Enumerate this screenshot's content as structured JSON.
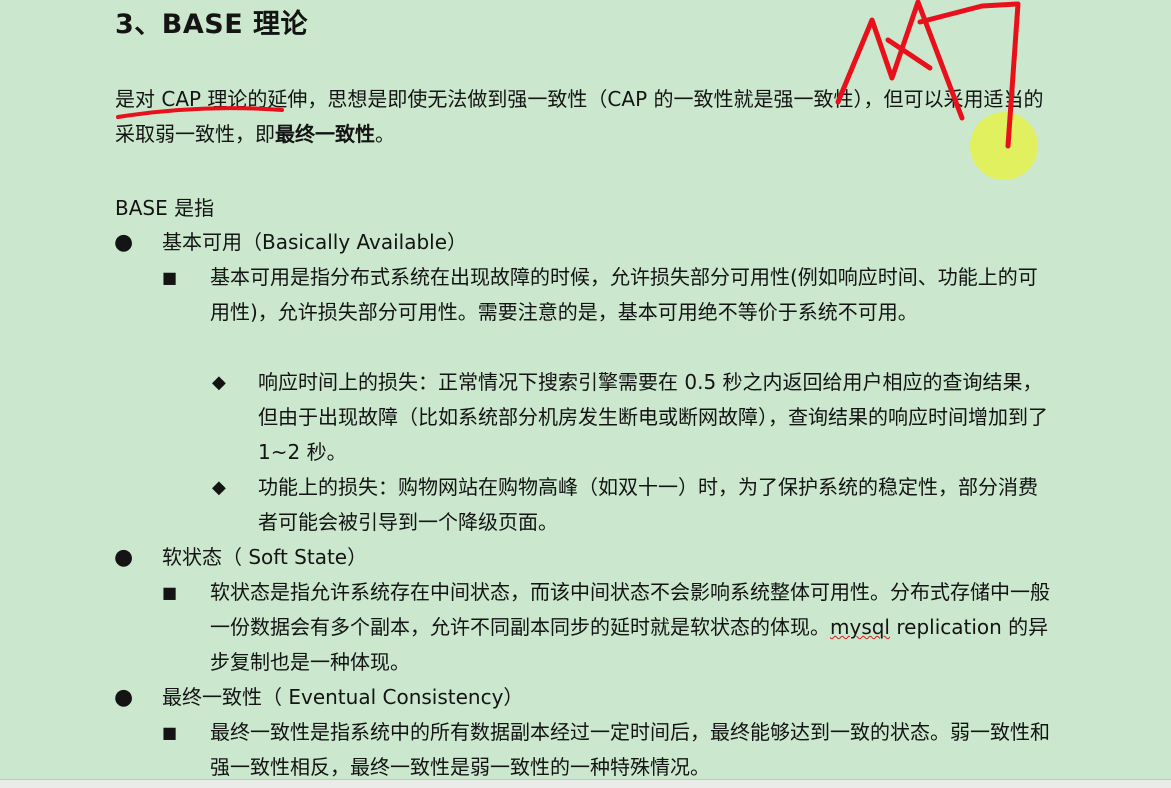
{
  "heading": "3、BASE 理论",
  "intro_para": {
    "part1": "是对 CAP 理论的延伸，思想是即使无法做到强一致性（CAP 的一致性就是强一致性），但可以采用适当的采取弱一致性，即",
    "bold": "最终一致性",
    "end": "。"
  },
  "base_intro": "BASE 是指",
  "sections": {
    "basic": {
      "title": "基本可用（Basically Available）",
      "desc": "基本可用是指分布式系统在出现故障的时候，允许损失部分可用性(例如响应时间、功能上的可用性)，允许损失部分可用性。需要注意的是，基本可用绝不等价于系统不可用。",
      "sub1": "响应时间上的损失：正常情况下搜索引擎需要在 0.5 秒之内返回给用户相应的查询结果，但由于出现故障（比如系统部分机房发生断电或断网故障），查询结果的响应时间增加到了 1~2 秒。",
      "sub2": "功能上的损失：购物网站在购物高峰（如双十一）时，为了保护系统的稳定性，部分消费者可能会被引导到一个降级页面。"
    },
    "soft": {
      "title": "软状态（  Soft State）",
      "desc_a": "软状态是指允许系统存在中间状态，而该中间状态不会影响系统整体可用性。分布式存储中一般一份数据会有多个副本，允许不同副本同步的延时就是软状态的体现。",
      "desc_mysql": "mysql",
      "desc_b": " replication 的异步复制也是一种体现。"
    },
    "eventual": {
      "title": "最终一致性（  Eventual Consistency）",
      "desc": "最终一致性是指系统中的所有数据副本经过一定时间后，最终能够达到一致的状态。弱一致性和强一致性相反，最终一致性是弱一致性的一种特殊情况。"
    }
  },
  "markers": {
    "bullet": "●",
    "square": "■",
    "diamond": "◆"
  },
  "colors": {
    "background": "#cbe8cf",
    "annotation_red": "#e8101a",
    "highlight_yellow": "#e4f14a"
  }
}
